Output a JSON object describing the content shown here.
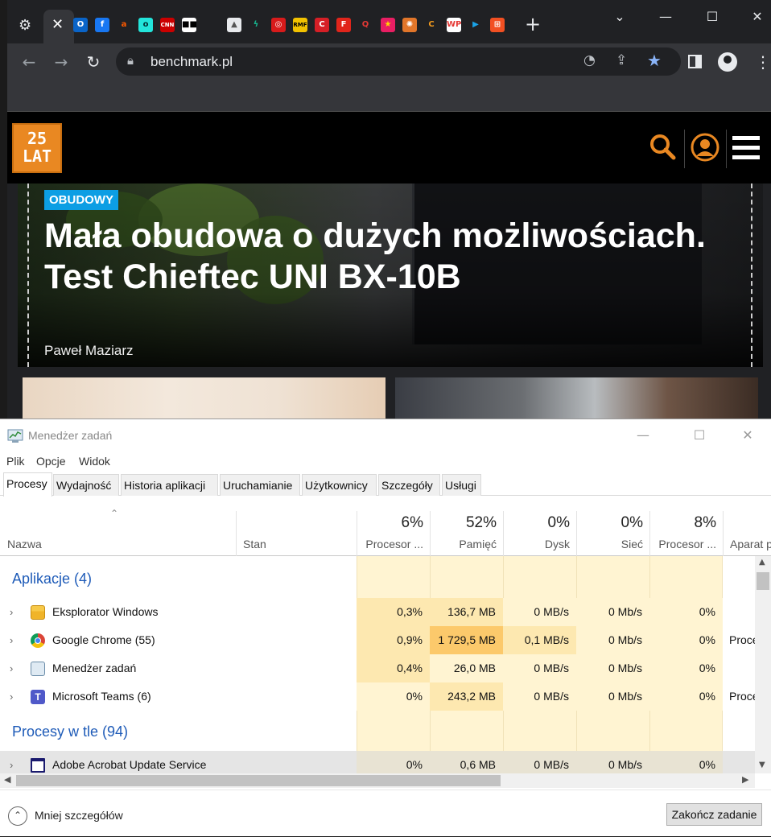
{
  "browser": {
    "url": "benchmark.pl",
    "tab_icons": [
      {
        "name": "outlook-icon",
        "bg": "#0a64c8",
        "glyph": "O"
      },
      {
        "name": "facebook-icon",
        "bg": "#1877f2",
        "glyph": "f"
      },
      {
        "name": "allegro-icon",
        "bg": "#202124",
        "glyph": "a",
        "color": "#ff5a00"
      },
      {
        "name": "olx-icon",
        "bg": "#23e5db",
        "glyph": "o",
        "color": "#002f34"
      },
      {
        "name": "cnn-icon",
        "bg": "#cc0000",
        "glyph": "CNN"
      },
      {
        "name": "news-icon",
        "bg": "#ffffff",
        "glyph": "■■",
        "color": "#000"
      },
      {
        "name": "mountain-icon",
        "bg": "#e8eaed",
        "glyph": "▲",
        "color": "#555"
      },
      {
        "name": "lightning-icon",
        "bg": "#202124",
        "glyph": "ϟ",
        "color": "#17b890"
      },
      {
        "name": "target-icon",
        "bg": "#d81b1b",
        "glyph": "◎"
      },
      {
        "name": "rmf-icon",
        "bg": "#f2c200",
        "glyph": "RMF",
        "color": "#000"
      },
      {
        "name": "c-red-icon",
        "bg": "#d61f26",
        "glyph": "C"
      },
      {
        "name": "f-red-icon",
        "bg": "#e1251b",
        "glyph": "F"
      },
      {
        "name": "q-icon",
        "bg": "#202124",
        "glyph": "Q",
        "color": "#e53935"
      },
      {
        "name": "star-icon",
        "bg": "#e91e63",
        "glyph": "★",
        "color": "#ffd600"
      },
      {
        "name": "swirl-icon",
        "bg": "#e2762a",
        "glyph": "✺"
      },
      {
        "name": "c-orange-icon",
        "bg": "#202124",
        "glyph": "C",
        "color": "#f39a1d"
      },
      {
        "name": "wp-icon",
        "bg": "#ffffff",
        "glyph": "WP",
        "color": "#e53935"
      },
      {
        "name": "play-icon",
        "bg": "#202124",
        "glyph": "▶",
        "color": "#1aa3e8"
      },
      {
        "name": "windows-icon",
        "bg": "#f25022",
        "glyph": "⊞"
      }
    ]
  },
  "site": {
    "logo_line1": "25",
    "logo_line2": "LAT",
    "hero": {
      "category": "OBUDOWY",
      "title": "Mała obudowa o dużych możliwościach. Test Chieftec UNI BX-10B",
      "author": "Paweł Maziarz"
    }
  },
  "taskmgr": {
    "title": "Menedżer zadań",
    "menu": [
      "Plik",
      "Opcje",
      "Widok"
    ],
    "tabs": [
      "Procesy",
      "Wydajność",
      "Historia aplikacji",
      "Uruchamianie",
      "Użytkownicy",
      "Szczegóły",
      "Usługi"
    ],
    "columns": {
      "name": "Nazwa",
      "status": "Stan",
      "cpu": {
        "pct": "6%",
        "label": "Procesor ..."
      },
      "mem": {
        "pct": "52%",
        "label": "Pamięć"
      },
      "disk": {
        "pct": "0%",
        "label": "Dysk"
      },
      "net": {
        "pct": "0%",
        "label": "Sieć"
      },
      "gpu": {
        "pct": "8%",
        "label": "Procesor ..."
      },
      "gpu_engine": {
        "label": "Aparat p"
      }
    },
    "groups": {
      "apps": "Aplikacje (4)",
      "background": "Procesy w tle (94)"
    },
    "apps": [
      {
        "name": "Eksplorator Windows",
        "cpu": "0,3%",
        "mem": "136,7 MB",
        "disk": "0 MB/s",
        "net": "0 Mb/s",
        "gpu": "0%",
        "engine": ""
      },
      {
        "name": "Google Chrome (55)",
        "cpu": "0,9%",
        "mem": "1 729,5 MB",
        "disk": "0,1 MB/s",
        "net": "0 Mb/s",
        "gpu": "0%",
        "engine": "Proce"
      },
      {
        "name": "Menedżer zadań",
        "cpu": "0,4%",
        "mem": "26,0 MB",
        "disk": "0 MB/s",
        "net": "0 Mb/s",
        "gpu": "0%",
        "engine": ""
      },
      {
        "name": "Microsoft Teams (6)",
        "cpu": "0%",
        "mem": "243,2 MB",
        "disk": "0 MB/s",
        "net": "0 Mb/s",
        "gpu": "0%",
        "engine": "Proce"
      }
    ],
    "background": [
      {
        "name": "Adobe Acrobat Update Service",
        "cpu": "0%",
        "mem": "0,6 MB",
        "disk": "0 MB/s",
        "net": "0 Mb/s",
        "gpu": "0%",
        "engine": ""
      }
    ],
    "footer": {
      "less_details": "Mniej szczegółów",
      "end_task": "Zakończ zadanie"
    }
  }
}
